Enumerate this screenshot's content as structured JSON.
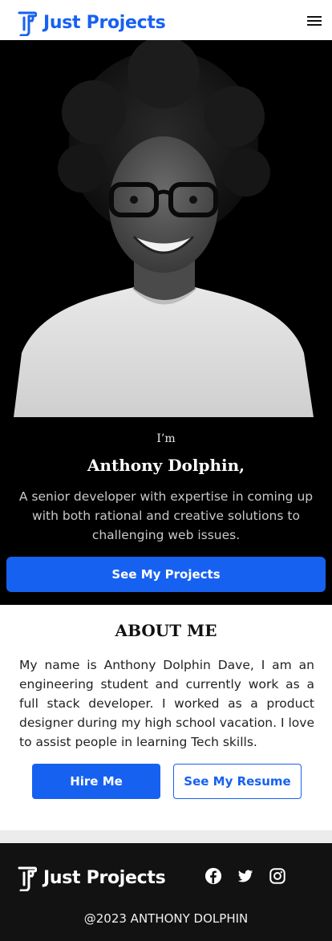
{
  "header": {
    "brand": "Just Projects",
    "menu_icon": "hamburger-menu-icon"
  },
  "hero": {
    "intro": "I’m",
    "name": "Anthony Dolphin,",
    "tagline": "A senior developer with expertise in coming up with both rational and creative solutions to challenging web issues.",
    "cta_label": "See My Projects",
    "photo": "portrait-photo"
  },
  "about": {
    "heading": "ABOUT ME",
    "body": "My name is Anthony Dolphin Dave, I am an engineering student and currently work as a full stack developer. I worked as a product designer during my high school vacation. I love to assist people in learning Tech skills.",
    "hire_label": "Hire Me",
    "resume_label": "See My Resume"
  },
  "footer": {
    "brand": "Just Projects",
    "social_icons": [
      "facebook-icon",
      "twitter-icon",
      "instagram-icon"
    ],
    "copyright": "@2023 ANTHONY DOLPHIN"
  },
  "colors": {
    "accent": "#1761f1",
    "hero_bg": "#000000",
    "footer_bg": "#121212"
  }
}
